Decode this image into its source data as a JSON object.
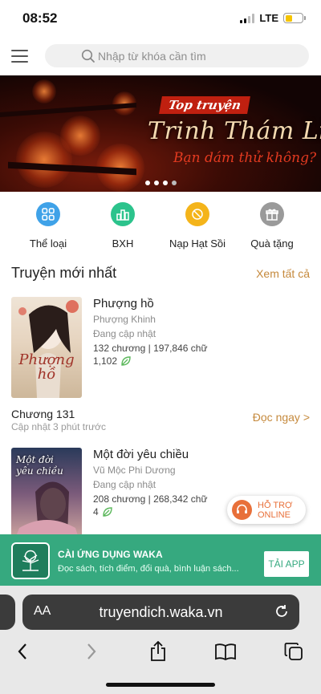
{
  "status_bar": {
    "time": "08:52",
    "network": "LTE"
  },
  "header": {
    "search_placeholder": "Nhập từ khóa cần tìm"
  },
  "banner": {
    "kicker": "Top truyện",
    "title": "Trinh Thám Linh Dị",
    "subtitle": "Bạn dám thử không?"
  },
  "categories": [
    {
      "label": "Thể loại",
      "icon": "grid-icon",
      "color": "#3fa2e8"
    },
    {
      "label": "BXH",
      "icon": "ranking-icon",
      "color": "#2cc38c"
    },
    {
      "label": "Nạp Hạt Sồi",
      "icon": "acorn-icon",
      "color": "#f4b41a"
    },
    {
      "label": "Quà tặng",
      "icon": "gift-icon",
      "color": "#9a9a9a"
    }
  ],
  "section": {
    "title": "Truyện mới nhất",
    "see_all": "Xem tất cả"
  },
  "books": [
    {
      "title": "Phượng hồ",
      "author": "Phượng Khinh",
      "status": "Đang cập nhật",
      "stats": "132 chương | 197,846 chữ",
      "likes": "1,102",
      "cover_text": "Phượng hồ",
      "chapter": "Chương 131",
      "updated": "Cập nhật 3 phút trước",
      "read_now": "Đọc ngay >"
    },
    {
      "title": "Một đời yêu chiều",
      "author": "Vũ Mộc Phi Dương",
      "status": "Đang cập nhật",
      "stats": "208 chương | 268,342 chữ",
      "likes": "4",
      "cover_text": "Một đời yêu chiều"
    }
  ],
  "support": {
    "line1": "HỖ TRỢ",
    "line2": "ONLINE"
  },
  "promo": {
    "title": "CÀI ỨNG DỤNG WAKA",
    "subtitle": "Đọc sách, tích điểm, đổi quà, bình luận sách...",
    "button": "TẢI APP"
  },
  "browser": {
    "aa": "AA",
    "url": "truyendich.waka.vn"
  },
  "colors": {
    "accent_gold": "#c5893c",
    "promo_green": "#36a97f",
    "leaf_green": "#5cb85c"
  }
}
